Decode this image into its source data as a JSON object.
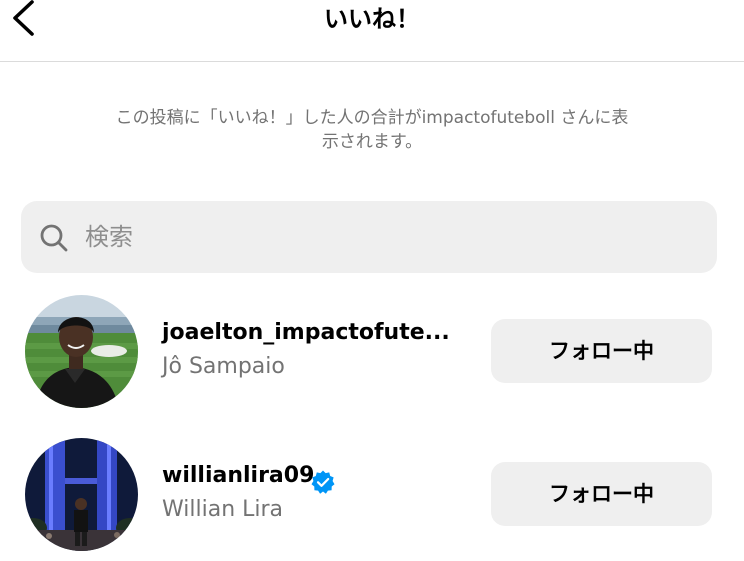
{
  "header": {
    "title": "いいね！",
    "back_icon": "chevron-left-icon"
  },
  "notice": {
    "line1": "この投稿に「いいね！」した人の合計がimpactofuteboll さんに表",
    "line2": "示されます。"
  },
  "search": {
    "placeholder": "検索",
    "value": "",
    "icon": "search-icon"
  },
  "users": [
    {
      "username": "joaelton_impactofute...",
      "full_name": "Jô Sampaio",
      "follow_label": "フォロー中",
      "verified": false
    },
    {
      "username": "willianlira09",
      "full_name": "Willian Lira",
      "follow_label": "フォロー中",
      "verified": true
    }
  ],
  "colors": {
    "secondary_text": "#737373",
    "button_bg": "#efefef",
    "verified_blue": "#0095f6",
    "divider": "#dbdbdb"
  }
}
